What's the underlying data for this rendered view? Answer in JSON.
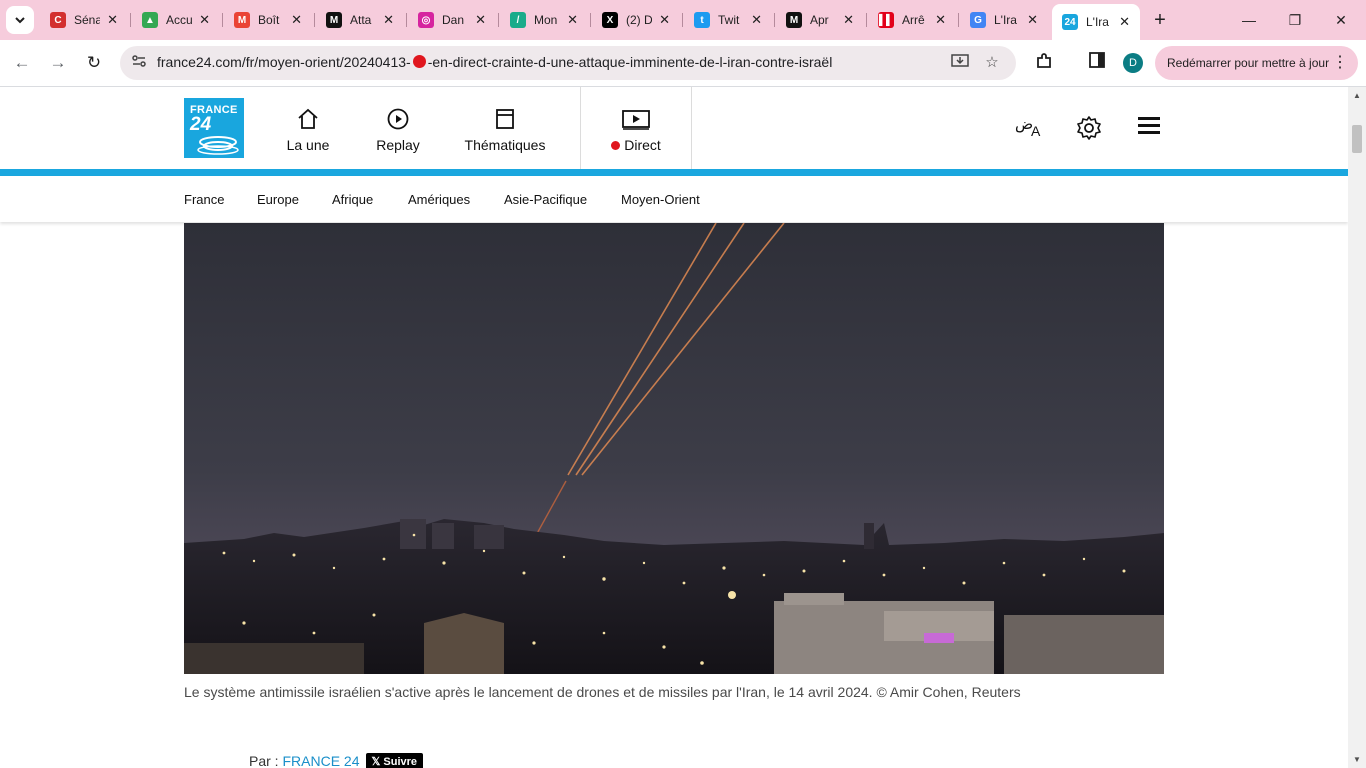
{
  "browser": {
    "tabs": [
      {
        "title": "Séna",
        "icon": "c-red-icon",
        "color": "#d32f2f",
        "glyph": "C"
      },
      {
        "title": "Accu",
        "icon": "google-drive-icon",
        "color": "#34a853",
        "glyph": "▲"
      },
      {
        "title": "Boît",
        "icon": "gmail-icon",
        "color": "#ea4335",
        "glyph": "M"
      },
      {
        "title": "Atta",
        "icon": "le-monde-icon",
        "color": "#111111",
        "glyph": "M"
      },
      {
        "title": "Dan",
        "icon": "instagram-icon",
        "color": "#d6249f",
        "glyph": "◎"
      },
      {
        "title": "Mon",
        "icon": "mediapart-icon",
        "color": "#1aab8a",
        "glyph": "/"
      },
      {
        "title": "(2) D",
        "icon": "x-icon",
        "color": "#000000",
        "glyph": "X"
      },
      {
        "title": "Twit",
        "icon": "twitter-icon",
        "color": "#1d9bf0",
        "glyph": "t"
      },
      {
        "title": "Apr",
        "icon": "le-monde-icon",
        "color": "#111111",
        "glyph": "M"
      },
      {
        "title": "Arrê",
        "icon": "liberation-icon",
        "color": "#e2001a",
        "glyph": "▌▌"
      },
      {
        "title": "L'Ira",
        "icon": "google-icon",
        "color": "#4285f4",
        "glyph": "G"
      },
      {
        "title": "L'Ira",
        "icon": "france24-icon",
        "color": "#19a6de",
        "glyph": "24",
        "active": true
      }
    ],
    "url_before": "france24.com/fr/moyen-orient/20240413-",
    "url_after": "-en-direct-crainte-d-une-attaque-imminente-de-l-iran-contre-israël",
    "profile_initial": "D",
    "update_label": "Redémarrer pour mettre à jour"
  },
  "site": {
    "logo_line1": "FRANCE",
    "logo_line2": "24",
    "nav": {
      "home": "La une",
      "replay": "Replay",
      "themes": "Thématiques",
      "live": "Direct"
    },
    "language_icon_text": "ض",
    "subnav": [
      "France",
      "Europe",
      "Afrique",
      "Amériques",
      "Asie-Pacifique",
      "Moyen-Orient"
    ],
    "accent_color": "#1aa7df",
    "live_color": "#e0161e"
  },
  "article": {
    "caption": "Le système antimissile israélien s'active après le lancement de drones et de missiles par l'Iran, le 14 avril 2024.  © Amir Cohen, Reuters",
    "byline_prefix": "Par : ",
    "author": "FRANCE 24",
    "follow_label": "Suivre"
  }
}
